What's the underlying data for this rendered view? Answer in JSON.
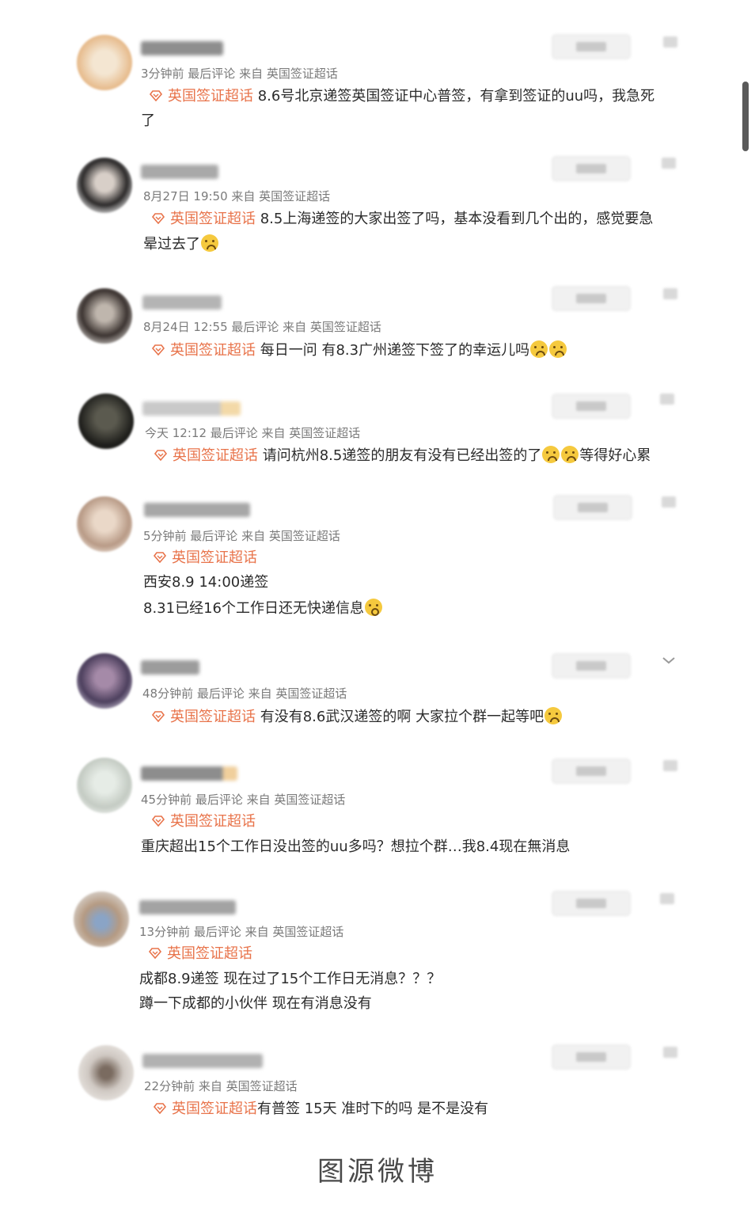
{
  "feed": {
    "posts": [
      {
        "meta": "3分钟前 最后评论 来自 英国签证超话",
        "topic": "英国签证超话",
        "lines": [
          "8.6号北京递签英国签证中心普签，有拿到签证的uu吗，我急死",
          "了"
        ]
      },
      {
        "meta": "8月27日 19:50 来自 英国签证超话",
        "topic": "英国签证超话",
        "lines": [
          "8.5上海递签的大家出签了吗，基本没看到几个出的，感觉要急",
          "晕过去了"
        ],
        "emoji": [
          "loudly-crying-face"
        ]
      },
      {
        "meta": "8月24日 12:55 最后评论 来自 英国签证超话",
        "topic": "英国签证超话",
        "lines": [
          "每日一问 有8.3广州递签下签了的幸运儿吗"
        ],
        "emoji": [
          "loudly-crying-face",
          "loudly-crying-face"
        ]
      },
      {
        "meta": "今天 12:12 最后评论 来自 英国签证超话",
        "topic": "英国签证超话",
        "lines": [
          "请问杭州8.5递签的朋友有没有已经出签的了",
          "等得好心累"
        ],
        "emoji": [
          "loudly-crying-face",
          "loudly-crying-face"
        ]
      },
      {
        "meta": "5分钟前 最后评论 来自 英国签证超话",
        "topic": "英国签证超话",
        "lines": [
          "西安8.9   14:00递签",
          "8.31已经16个工作日还无快递信息"
        ],
        "emoji": [
          "face-screaming-in-fear"
        ]
      },
      {
        "meta": "48分钟前 最后评论 来自 英国签证超话",
        "topic": "英国签证超话",
        "lines": [
          "有没有8.6武汉递签的啊 大家拉个群一起等吧"
        ],
        "emoji": [
          "loudly-crying-face"
        ]
      },
      {
        "meta": "45分钟前 最后评论 来自 英国签证超话",
        "topic": "英国签证超话",
        "lines": [
          "重庆超出15个工作日没出签的uu多吗？想拉个群…我8.4现在無消息"
        ]
      },
      {
        "meta": "13分钟前 最后评论 来自 英国签证超话",
        "topic": "英国签证超话",
        "lines": [
          "成都8.9递签 现在过了15个工作日无消息？？？",
          "蹲一下成都的小伙伴 现在有消息没有"
        ]
      },
      {
        "meta": "22分钟前 来自 英国签证超话",
        "topic": "英国签证超话",
        "lines": [
          "有普签 15天 准时下的吗 是不是没有"
        ]
      }
    ]
  },
  "caption": "图源微博"
}
